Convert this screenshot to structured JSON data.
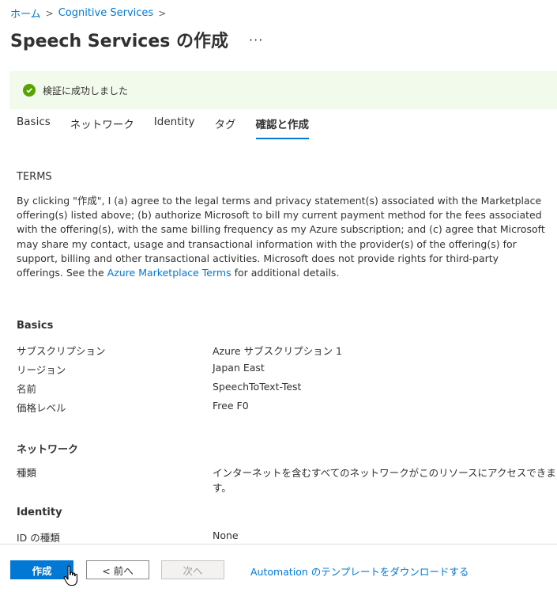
{
  "breadcrumb": {
    "items": [
      "ホーム",
      "Cognitive Services"
    ],
    "separator": ">"
  },
  "page": {
    "title": "Speech Services の作成",
    "more": "···"
  },
  "banner": {
    "text": "検証に成功しました",
    "icon": "check-circle-icon",
    "color": "#57a300"
  },
  "tabs": [
    {
      "label": "Basics",
      "active": false
    },
    {
      "label": "ネットワーク",
      "active": false
    },
    {
      "label": "Identity",
      "active": false
    },
    {
      "label": "タグ",
      "active": false
    },
    {
      "label": "確認と作成",
      "active": true
    }
  ],
  "terms": {
    "heading": "TERMS",
    "body_before_link": "By clicking \"作成\", I (a) agree to the legal terms and privacy statement(s) associated with the Marketplace offering(s) listed above; (b) authorize Microsoft to bill my current payment method for the fees associated with the offering(s), with the same billing frequency as my Azure subscription; and (c) agree that Microsoft may share my contact, usage and transactional information with the provider(s) of the offering(s) for support, billing and other transactional activities. Microsoft does not provide rights for third-party offerings. See the ",
    "link_text": "Azure Marketplace Terms",
    "body_after_link": " for additional details."
  },
  "sections": {
    "basics": {
      "heading": "Basics",
      "rows": [
        {
          "label": "サブスクリプション",
          "value": "Azure サブスクリプション 1"
        },
        {
          "label": "リージョン",
          "value": "Japan East"
        },
        {
          "label": "名前",
          "value": "SpeechToText-Test"
        },
        {
          "label": "価格レベル",
          "value": "Free F0"
        }
      ]
    },
    "network": {
      "heading": "ネットワーク",
      "rows": [
        {
          "label": "種類",
          "value": "インターネットを含むすべてのネットワークがこのリソースにアクセスできます。"
        }
      ]
    },
    "identity": {
      "heading": "Identity",
      "rows": [
        {
          "label": "ID の種類",
          "value": "None"
        }
      ]
    }
  },
  "footer": {
    "create_label": "作成",
    "prev_label": "< 前へ",
    "next_label": "次へ",
    "download_link": "Automation のテンプレートをダウンロードする"
  },
  "colors": {
    "accent": "#0078d4",
    "success_bg": "#f1faeb"
  }
}
